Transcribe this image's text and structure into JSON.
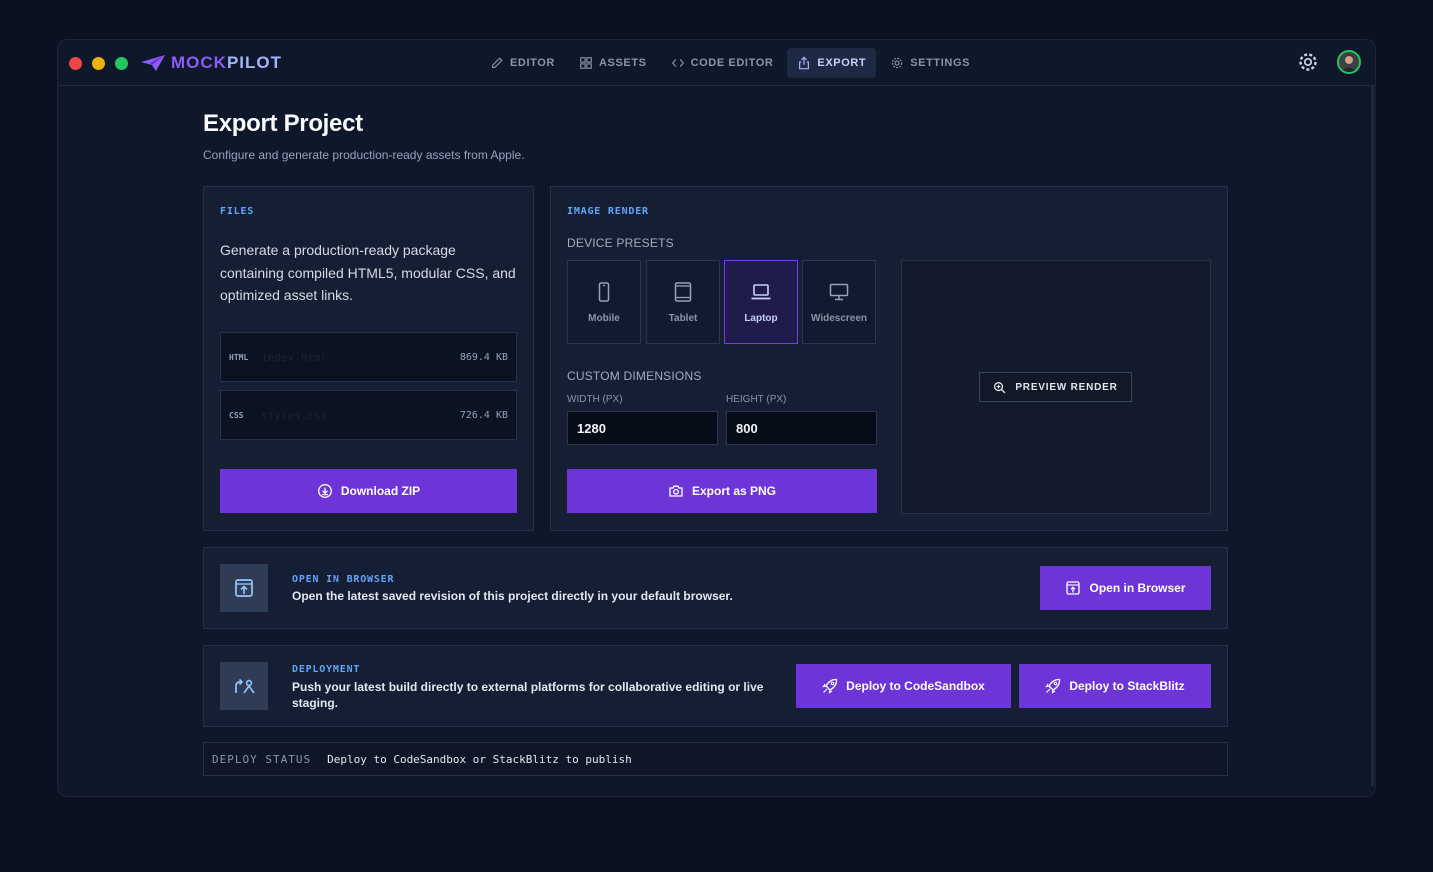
{
  "app": {
    "logo_part1": "MOCK",
    "logo_part2": "PILOT"
  },
  "nav": {
    "items": [
      {
        "label": "EDITOR"
      },
      {
        "label": "ASSETS"
      },
      {
        "label": "CODE EDITOR"
      },
      {
        "label": "EXPORT"
      },
      {
        "label": "SETTINGS"
      }
    ]
  },
  "page": {
    "title": "Export Project",
    "subtitle": "Configure and generate production-ready assets from Apple."
  },
  "files": {
    "label": "FILES",
    "description": "Generate a production-ready package containing compiled HTML5, modular CSS, and optimized asset links.",
    "rows": [
      {
        "ext": "HTML",
        "name": "index.html",
        "size": "869.4 KB"
      },
      {
        "ext": "CSS",
        "name": "styles.css",
        "size": "726.4 KB"
      }
    ],
    "download_label": "Download ZIP"
  },
  "render": {
    "label": "IMAGE RENDER",
    "presets_heading": "DEVICE PRESETS",
    "presets": [
      {
        "label": "Mobile"
      },
      {
        "label": "Tablet"
      },
      {
        "label": "Laptop"
      },
      {
        "label": "Widescreen"
      }
    ],
    "selected_preset": "Laptop",
    "custom_heading": "CUSTOM DIMENSIONS",
    "width_label": "WIDTH (PX)",
    "height_label": "HEIGHT (PX)",
    "width_value": "1280",
    "height_value": "800",
    "export_label": "Export as PNG",
    "preview_label": "PREVIEW RENDER"
  },
  "browser": {
    "label": "OPEN IN BROWSER",
    "text": "Open the latest saved revision of this project directly in your default browser.",
    "button": "Open in Browser"
  },
  "deploy": {
    "label": "DEPLOYMENT",
    "text": "Push your latest build directly to external platforms for collaborative editing or live staging.",
    "codesandbox": "Deploy to CodeSandbox",
    "stackblitz": "Deploy to StackBlitz"
  },
  "status": {
    "key": "DEPLOY STATUS",
    "value": "Deploy to CodeSandbox or StackBlitz to publish"
  },
  "colors": {
    "accent": "#6d35d8",
    "label_blue": "#60a5fa",
    "background": "#0f172a"
  }
}
